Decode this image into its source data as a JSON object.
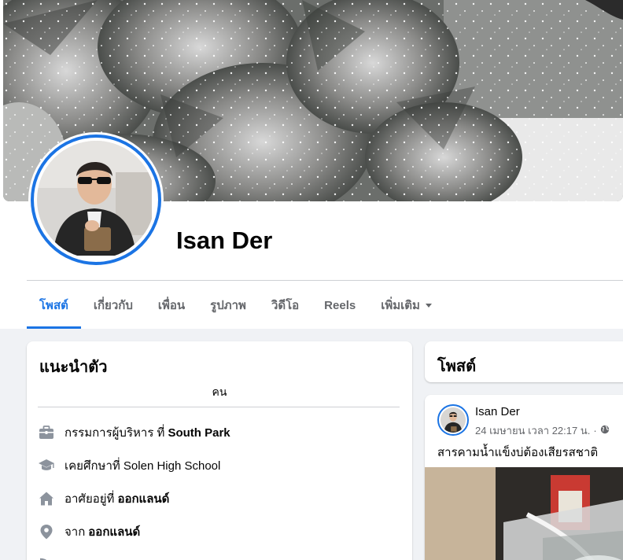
{
  "profile": {
    "name": "Isan Der"
  },
  "tabs": [
    {
      "label": "โพสต์",
      "active": true
    },
    {
      "label": "เกี่ยวกับ",
      "active": false
    },
    {
      "label": "เพื่อน",
      "active": false
    },
    {
      "label": "รูปภาพ",
      "active": false
    },
    {
      "label": "วิดีโอ",
      "active": false
    },
    {
      "label": "Reels",
      "active": false
    },
    {
      "label": "เพิ่มเติม",
      "active": false,
      "has_dropdown": true
    }
  ],
  "intro": {
    "title": "แนะนำตัว",
    "bio": "คน",
    "items": [
      {
        "icon": "briefcase-icon",
        "prefix": "กรรมการผู้บริหาร ที่",
        "value": "South Park"
      },
      {
        "icon": "graduation-cap-icon",
        "prefix": "เคยศึกษาที่ Solen High School",
        "value": ""
      },
      {
        "icon": "home-icon",
        "prefix": "อาศัยอยู่ที่",
        "value": "ออกแลนด์"
      },
      {
        "icon": "location-pin-icon",
        "prefix": "จาก",
        "value": "ออกแลนด์"
      }
    ]
  },
  "posts": {
    "title": "โพสต์",
    "post": {
      "author": "Isan Der",
      "timestamp": "24 เมษายน เวลา 22:17 น.",
      "separator": "·",
      "privacy_icon": "globe-icon",
      "text": "สารคามน้ำแข็งบ่ต้องเสียรสชาติ"
    }
  },
  "colors": {
    "accent": "#1b74e4",
    "secondary_text": "#65676b",
    "page_bg": "#f0f2f5"
  }
}
